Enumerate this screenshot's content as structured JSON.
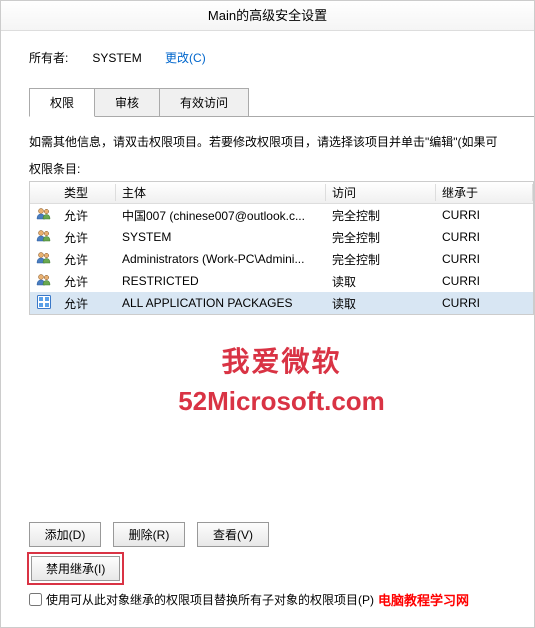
{
  "title": "Main的高级安全设置",
  "owner": {
    "label": "所有者:",
    "value": "SYSTEM",
    "change_link": "更改(C)"
  },
  "tabs": {
    "permissions": "权限",
    "audit": "审核",
    "effective": "有效访问"
  },
  "info_text": "如需其他信息，请双击权限项目。若要修改权限项目，请选择该项目并单击\"编辑\"(如果可",
  "entries_label": "权限条目:",
  "columns": {
    "type": "类型",
    "principal": "主体",
    "access": "访问",
    "inherit": "继承于"
  },
  "rows": [
    {
      "type": "允许",
      "principal": "中国007 (chinese007@outlook.c...",
      "access": "完全控制",
      "inherit": "CURRI"
    },
    {
      "type": "允许",
      "principal": "SYSTEM",
      "access": "完全控制",
      "inherit": "CURRI"
    },
    {
      "type": "允许",
      "principal": "Administrators (Work-PC\\Admini...",
      "access": "完全控制",
      "inherit": "CURRI"
    },
    {
      "type": "允许",
      "principal": "RESTRICTED",
      "access": "读取",
      "inherit": "CURRI"
    },
    {
      "type": "允许",
      "principal": "ALL APPLICATION PACKAGES",
      "access": "读取",
      "inherit": "CURRI"
    }
  ],
  "watermark": {
    "line1": "我爱微软",
    "line2": "52Microsoft.com"
  },
  "buttons": {
    "add": "添加(D)",
    "remove": "删除(R)",
    "view": "查看(V)",
    "disable_inherit": "禁用继承(I)"
  },
  "checkbox_label": "使用可从此对象继承的权限项目替换所有子对象的权限项目(P)",
  "red_note": "电脑教程学习网"
}
